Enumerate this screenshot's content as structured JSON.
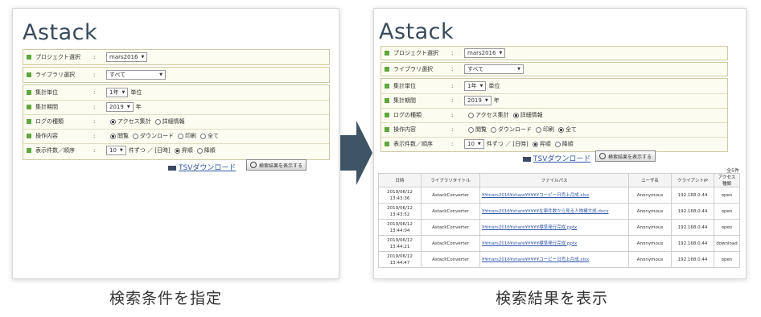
{
  "app": {
    "logo": "Astack"
  },
  "left": {
    "form": {
      "project_label": "プロジェクト選択",
      "project_value": "mars2016",
      "library_label": "ライブラリ選択",
      "library_value": "すべて",
      "unit_label": "集計単位",
      "unit_value": "1年",
      "unit_suffix": "単位",
      "period_label": "集計期間",
      "period_value": "2019",
      "period_suffix": "年",
      "logtype_label": "ログの種類",
      "logtype_opt1": "アクセス集計",
      "logtype_opt2": "詳細情報",
      "op_label": "操作内容",
      "op_opt1": "閲覧",
      "op_opt2": "ダウンロード",
      "op_opt3": "印刷",
      "op_opt4": "全て",
      "display_label": "表示件数／順序",
      "display_value": "10",
      "display_suffix": "件ずつ ／ [日時]",
      "order_opt1": "昇順",
      "order_opt2": "降順",
      "colon": ":"
    },
    "tsv": "TSVダウンロード",
    "search_button": "検索結果を表示する"
  },
  "right": {
    "count": "全5件",
    "table": {
      "headers": [
        "日時",
        "ライブラリタイトル",
        "ファイルパス",
        "ユーザ名",
        "クライアントIP",
        "アクセス種類"
      ],
      "rows": [
        {
          "date": "2019/06/12",
          "time": "13:43:36",
          "lib": "AstackConverter",
          "path": "¥¥mars2016¥share¥¥¥¥¥コーピー日売上月成.xlsx",
          "user": "Anonymous",
          "ip": "192.168.0.44",
          "type": "open"
        },
        {
          "date": "2019/06/12",
          "time": "13:43:52",
          "lib": "AstackConverter",
          "path": "¥¥mars2016¥share¥¥¥¥¥在庫件数から見る人物構文成.docx",
          "user": "Anonymous",
          "ip": "192.168.0.44",
          "type": "open"
        },
        {
          "date": "2019/06/12",
          "time": "13:44:04",
          "lib": "AstackConverter",
          "path": "¥¥mars2016¥share¥¥¥¥¥標準発行完成.pptx",
          "user": "Anonymous",
          "ip": "192.168.0.44",
          "type": "open"
        },
        {
          "date": "2019/06/12",
          "time": "13:44:21",
          "lib": "AstackConverter",
          "path": "¥¥mars2016¥share¥¥¥¥¥標準発行完成.pptx",
          "user": "Anonymous",
          "ip": "192.168.0.44",
          "type": "download"
        },
        {
          "date": "2019/06/12",
          "time": "13:44:47",
          "lib": "AstackConverter",
          "path": "¥¥mars2016¥share¥¥¥¥¥コーピー日売上月成.xlsx",
          "user": "Anonymous",
          "ip": "192.168.0.44",
          "type": "open"
        }
      ]
    }
  },
  "captions": {
    "left": "検索条件を指定",
    "right": "検索結果を表示"
  },
  "colors": {
    "accent_green": "#5ea83d",
    "arrow": "#3f5566",
    "link": "#3156a8"
  }
}
